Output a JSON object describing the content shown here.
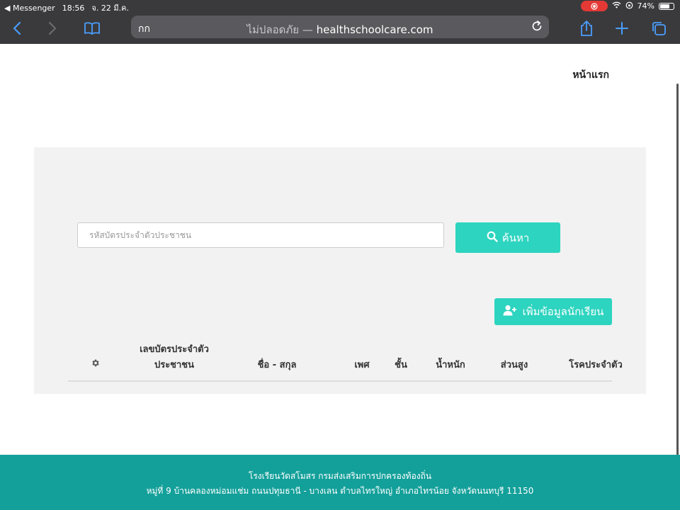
{
  "status_bar": {
    "back_app": "◀ Messenger",
    "time": "18:56",
    "date": "จ. 22 มี.ค.",
    "battery": "74%",
    "battery_level": 0.74
  },
  "browser": {
    "text_size_label": "กก",
    "url_status": "ไม่ปลอดภัย",
    "url_separator": " — ",
    "url_domain": "healthschoolcare.com"
  },
  "nav": {
    "home_label": "หน้าแรก"
  },
  "search": {
    "placeholder": "รหัสบัตรประจำตัวประชาชน",
    "button_label": "ค้นหา"
  },
  "add_student": {
    "label": "เพิ่มข้อมูลนักเรียน"
  },
  "table": {
    "columns": [
      {
        "line1": "เลขบัตรประจำตัว",
        "line2": "ประชาชน"
      },
      {
        "line1": "ชื่อ - สกุล"
      },
      {
        "line1": "เพศ"
      },
      {
        "line1": "ชั้น"
      },
      {
        "line1": "น้ำหนัก"
      },
      {
        "line1": "ส่วนสูง"
      },
      {
        "line1": "โรคประจำตัว"
      }
    ]
  },
  "footer": {
    "line1": "โรงเรียนวัดสโมสร กรมส่งเสริมการปกครองท้องถิ่น",
    "line2": "หมู่ที่ 9 บ้านคลองหม่อมแช่ม ถนนปทุมธานี - บางเลน ตำบลไทรใหญ่ อำเภอไทรน้อย จังหวัดนนทบุรี 11150"
  },
  "colors": {
    "accent": "#2dd4bf",
    "footer": "#14a09a",
    "browser_chrome": "#3a3a3c",
    "recording": "#e53935"
  }
}
